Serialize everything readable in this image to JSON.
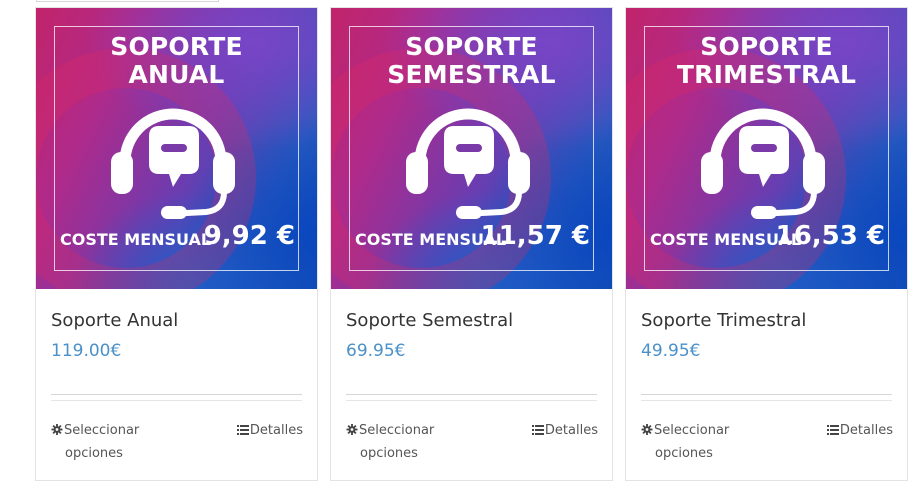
{
  "products": [
    {
      "banner_line1": "SOPORTE",
      "banner_line2": "ANUAL",
      "cost_label": "COSTE MENSUAL",
      "cost_value": "9,92 €",
      "name": "Soporte Anual",
      "price": "119.00€",
      "select_line1": "Seleccionar",
      "select_line2": "opciones",
      "details_label": "Detalles"
    },
    {
      "banner_line1": "SOPORTE",
      "banner_line2": "SEMESTRAL",
      "cost_label": "COSTE MENSUAL",
      "cost_value": "11,57 €",
      "name": "Soporte Semestral",
      "price": "69.95€",
      "select_line1": "Seleccionar",
      "select_line2": "opciones",
      "details_label": "Detalles"
    },
    {
      "banner_line1": "SOPORTE",
      "banner_line2": "TRIMESTRAL",
      "cost_label": "COSTE MENSUAL",
      "cost_value": "16,53 €",
      "name": "Soporte Trimestral",
      "price": "49.95€",
      "select_line1": "Seleccionar",
      "select_line2": "opciones",
      "details_label": "Detalles"
    }
  ],
  "icons": {
    "banner": "headset-chat-icon",
    "select": "gear-icon",
    "details": "list-icon"
  },
  "colors": {
    "price": "#4a90c9",
    "banner_magenta": "#c1246a",
    "banner_blue": "#1453b5"
  }
}
